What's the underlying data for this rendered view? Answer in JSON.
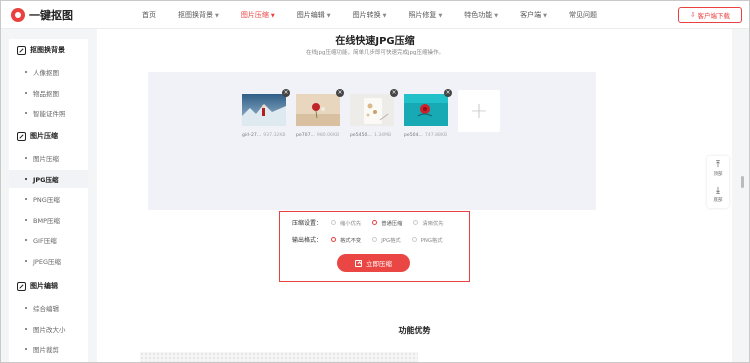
{
  "header": {
    "logo_text": "一键抠图",
    "nav": [
      {
        "label": "首页",
        "has_caret": false,
        "active": false
      },
      {
        "label": "抠图换背景",
        "has_caret": true,
        "active": false
      },
      {
        "label": "图片压缩",
        "has_caret": true,
        "active": true
      },
      {
        "label": "图片编辑",
        "has_caret": true,
        "active": false
      },
      {
        "label": "图片转换",
        "has_caret": true,
        "active": false
      },
      {
        "label": "照片修复",
        "has_caret": true,
        "active": false
      },
      {
        "label": "特色功能",
        "has_caret": true,
        "active": false
      },
      {
        "label": "客户端",
        "has_caret": true,
        "active": false
      },
      {
        "label": "常见问题",
        "has_caret": false,
        "active": false
      }
    ],
    "download_label": "客户端下载"
  },
  "sidebar": {
    "groups": [
      {
        "label": "抠图换背景",
        "items": [
          "人像抠图",
          "物品抠图",
          "智能证件照"
        ]
      },
      {
        "label": "图片压缩",
        "items": [
          "图片压缩",
          "JPG压缩",
          "PNG压缩",
          "BMP压缩",
          "GIF压缩",
          "JPEG压缩"
        ]
      },
      {
        "label": "图片编辑",
        "items": [
          "综合编辑",
          "图片改大小",
          "图片裁剪"
        ]
      }
    ],
    "active_item": "JPG压缩"
  },
  "main": {
    "title": "在线快速JPG压缩",
    "subtitle": "在线jpg压缩功能，简单几步即可快速完成jpg压缩操作。",
    "thumbs": [
      {
        "name": "girl-27...",
        "size": "937.32KB"
      },
      {
        "name": "pe707...",
        "size": "980.06KB"
      },
      {
        "name": "pe5450...",
        "size": "1.34MB"
      },
      {
        "name": "pe504...",
        "size": "747.88KB"
      }
    ],
    "add_symbol": "+",
    "settings": {
      "compress_label": "压缩设置：",
      "compress_options": [
        "缩小优先",
        "普通压缩",
        "清晰优先"
      ],
      "compress_selected": "普通压缩",
      "format_label": "输出格式：",
      "format_options": [
        "格式不变",
        "JPG格式",
        "PNG格式"
      ],
      "format_selected": "格式不变",
      "start_label": "立即压缩"
    }
  },
  "advantages": {
    "title": "功能优势"
  },
  "float_bar": {
    "top_label": "顶部",
    "bottom_label": "底部"
  },
  "colors": {
    "accent": "#e8413f",
    "upload_bg": "#f0f2f8"
  }
}
